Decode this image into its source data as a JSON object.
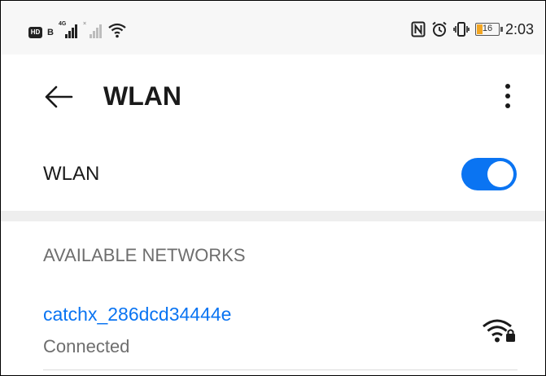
{
  "status_bar": {
    "hd_label": "HD",
    "sim_label": "B",
    "sim1_tag": "4G",
    "sim2_tag": "×",
    "battery_level": "16",
    "time": "2:03",
    "icons": [
      "hd-voice-icon",
      "signal-icon",
      "wifi-status-icon",
      "nfc-icon",
      "alarm-icon",
      "vibrate-icon",
      "battery-icon"
    ]
  },
  "header": {
    "title": "WLAN",
    "back_icon": "back-arrow-icon",
    "more_icon": "more-vert-icon"
  },
  "wlan_toggle": {
    "label": "WLAN",
    "enabled": true,
    "accent_color": "#0a74f2"
  },
  "networks": {
    "section_title": "AVAILABLE NETWORKS",
    "items": [
      {
        "ssid": "catchx_286dcd34444e",
        "status": "Connected",
        "icon": "wifi-lock-icon"
      }
    ]
  }
}
